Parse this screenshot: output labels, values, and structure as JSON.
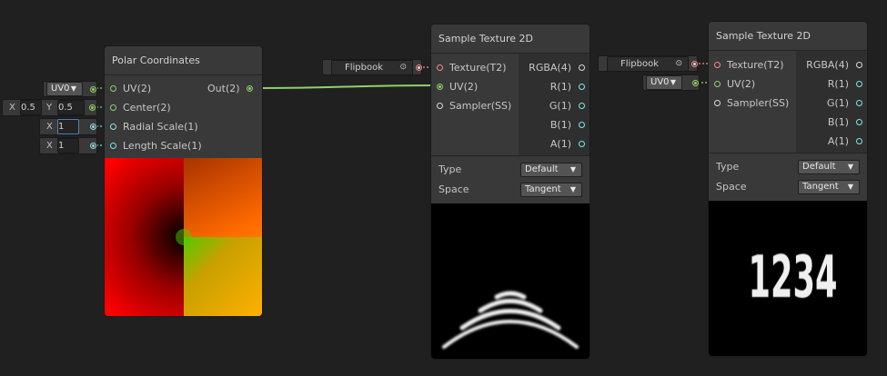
{
  "polar": {
    "title": "Polar Coordinates",
    "inputs": [
      "UV(2)",
      "Center(2)",
      "Radial Scale(1)",
      "Length Scale(1)"
    ],
    "output": "Out(2)"
  },
  "controls": {
    "uv0": "UV0",
    "center": {
      "x_label": "X",
      "x": "0.5",
      "y_label": "Y",
      "y": "0.5"
    },
    "radial": {
      "x_label": "X",
      "x": "1"
    },
    "length": {
      "x_label": "X",
      "x": "1"
    }
  },
  "flipbook_label": "Flipbook",
  "flipbook_label2": "Flipbook",
  "uv_dropdown": "UV0",
  "sample1": {
    "title": "Sample Texture 2D",
    "inputs": [
      "Texture(T2)",
      "UV(2)",
      "Sampler(SS)"
    ],
    "outputs": [
      "RGBA(4)",
      "R(1)",
      "G(1)",
      "B(1)",
      "A(1)"
    ],
    "type_label": "Type",
    "type_value": "Default",
    "space_label": "Space",
    "space_value": "Tangent"
  },
  "sample2": {
    "title": "Sample Texture 2D",
    "inputs": [
      "Texture(T2)",
      "UV(2)",
      "Sampler(SS)"
    ],
    "outputs": [
      "RGBA(4)",
      "R(1)",
      "G(1)",
      "B(1)",
      "A(1)"
    ],
    "type_label": "Type",
    "type_value": "Default",
    "space_label": "Space",
    "space_value": "Tangent"
  },
  "digits": [
    "1",
    "2",
    "3",
    "4"
  ],
  "colors": {
    "background": "#202020",
    "node": "#393939",
    "edge": "#8fd16a",
    "texture_port": "#f38a8a",
    "vector_port": "#84e4e7"
  }
}
